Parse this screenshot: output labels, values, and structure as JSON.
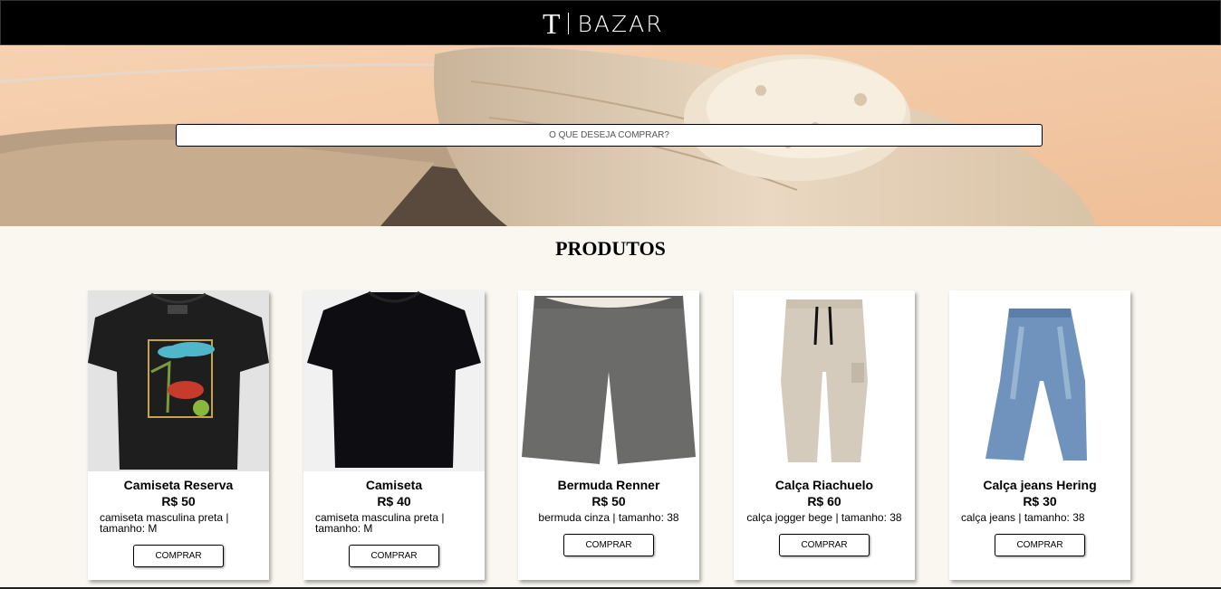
{
  "brand": {
    "mark": "T",
    "name": "BAZAR"
  },
  "search": {
    "placeholder": "O QUE DESEJA COMPRAR?"
  },
  "section": {
    "title": "PRODUTOS"
  },
  "products": [
    {
      "name": "Camiseta Reserva",
      "price": "R$ 50",
      "desc_line1": "camiseta masculina preta |",
      "desc_line2": "tamanho: M",
      "button": "COMPRAR",
      "image": "black-printed-tshirt"
    },
    {
      "name": "Camiseta",
      "price": "R$ 40",
      "desc_line1": "camiseta masculina preta |",
      "desc_line2": "tamanho: M",
      "button": "COMPRAR",
      "image": "black-plain-tshirt"
    },
    {
      "name": "Bermuda Renner",
      "price": "R$ 50",
      "desc_line1": "bermuda cinza | tamanho: 38",
      "button": "COMPRAR",
      "image": "grey-shorts"
    },
    {
      "name": "Calça Riachuelo",
      "price": "R$ 60",
      "desc_line1": "calça jogger bege | tamanho: 38",
      "button": "COMPRAR",
      "image": "beige-jogger-pants"
    },
    {
      "name": "Calça jeans Hering",
      "price": "R$ 30",
      "desc_line1": "calça jeans | tamanho: 38",
      "button": "COMPRAR",
      "image": "blue-jeans"
    }
  ],
  "colors": {
    "topbar": "#000000",
    "page_bg": "#faf7f1",
    "card_bg": "#ffffff",
    "hero_bg": "#f4c8a4"
  }
}
